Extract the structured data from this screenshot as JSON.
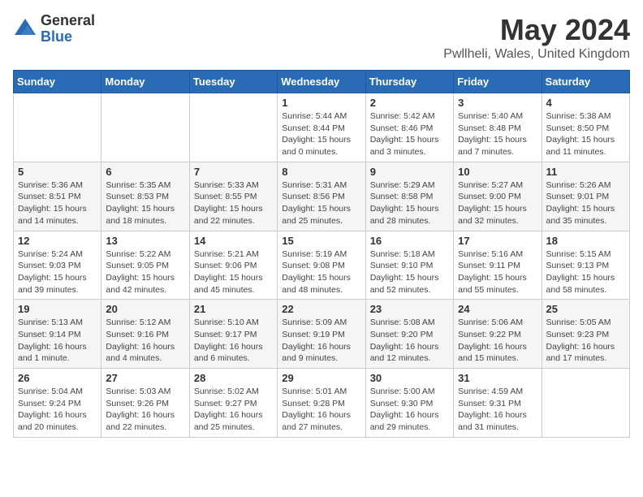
{
  "logo": {
    "general": "General",
    "blue": "Blue"
  },
  "header": {
    "title": "May 2024",
    "subtitle": "Pwllheli, Wales, United Kingdom"
  },
  "weekdays": [
    "Sunday",
    "Monday",
    "Tuesday",
    "Wednesday",
    "Thursday",
    "Friday",
    "Saturday"
  ],
  "weeks": [
    [
      {
        "day": "",
        "info": ""
      },
      {
        "day": "",
        "info": ""
      },
      {
        "day": "",
        "info": ""
      },
      {
        "day": "1",
        "info": "Sunrise: 5:44 AM\nSunset: 8:44 PM\nDaylight: 15 hours\nand 0 minutes."
      },
      {
        "day": "2",
        "info": "Sunrise: 5:42 AM\nSunset: 8:46 PM\nDaylight: 15 hours\nand 3 minutes."
      },
      {
        "day": "3",
        "info": "Sunrise: 5:40 AM\nSunset: 8:48 PM\nDaylight: 15 hours\nand 7 minutes."
      },
      {
        "day": "4",
        "info": "Sunrise: 5:38 AM\nSunset: 8:50 PM\nDaylight: 15 hours\nand 11 minutes."
      }
    ],
    [
      {
        "day": "5",
        "info": "Sunrise: 5:36 AM\nSunset: 8:51 PM\nDaylight: 15 hours\nand 14 minutes."
      },
      {
        "day": "6",
        "info": "Sunrise: 5:35 AM\nSunset: 8:53 PM\nDaylight: 15 hours\nand 18 minutes."
      },
      {
        "day": "7",
        "info": "Sunrise: 5:33 AM\nSunset: 8:55 PM\nDaylight: 15 hours\nand 22 minutes."
      },
      {
        "day": "8",
        "info": "Sunrise: 5:31 AM\nSunset: 8:56 PM\nDaylight: 15 hours\nand 25 minutes."
      },
      {
        "day": "9",
        "info": "Sunrise: 5:29 AM\nSunset: 8:58 PM\nDaylight: 15 hours\nand 28 minutes."
      },
      {
        "day": "10",
        "info": "Sunrise: 5:27 AM\nSunset: 9:00 PM\nDaylight: 15 hours\nand 32 minutes."
      },
      {
        "day": "11",
        "info": "Sunrise: 5:26 AM\nSunset: 9:01 PM\nDaylight: 15 hours\nand 35 minutes."
      }
    ],
    [
      {
        "day": "12",
        "info": "Sunrise: 5:24 AM\nSunset: 9:03 PM\nDaylight: 15 hours\nand 39 minutes."
      },
      {
        "day": "13",
        "info": "Sunrise: 5:22 AM\nSunset: 9:05 PM\nDaylight: 15 hours\nand 42 minutes."
      },
      {
        "day": "14",
        "info": "Sunrise: 5:21 AM\nSunset: 9:06 PM\nDaylight: 15 hours\nand 45 minutes."
      },
      {
        "day": "15",
        "info": "Sunrise: 5:19 AM\nSunset: 9:08 PM\nDaylight: 15 hours\nand 48 minutes."
      },
      {
        "day": "16",
        "info": "Sunrise: 5:18 AM\nSunset: 9:10 PM\nDaylight: 15 hours\nand 52 minutes."
      },
      {
        "day": "17",
        "info": "Sunrise: 5:16 AM\nSunset: 9:11 PM\nDaylight: 15 hours\nand 55 minutes."
      },
      {
        "day": "18",
        "info": "Sunrise: 5:15 AM\nSunset: 9:13 PM\nDaylight: 15 hours\nand 58 minutes."
      }
    ],
    [
      {
        "day": "19",
        "info": "Sunrise: 5:13 AM\nSunset: 9:14 PM\nDaylight: 16 hours\nand 1 minute."
      },
      {
        "day": "20",
        "info": "Sunrise: 5:12 AM\nSunset: 9:16 PM\nDaylight: 16 hours\nand 4 minutes."
      },
      {
        "day": "21",
        "info": "Sunrise: 5:10 AM\nSunset: 9:17 PM\nDaylight: 16 hours\nand 6 minutes."
      },
      {
        "day": "22",
        "info": "Sunrise: 5:09 AM\nSunset: 9:19 PM\nDaylight: 16 hours\nand 9 minutes."
      },
      {
        "day": "23",
        "info": "Sunrise: 5:08 AM\nSunset: 9:20 PM\nDaylight: 16 hours\nand 12 minutes."
      },
      {
        "day": "24",
        "info": "Sunrise: 5:06 AM\nSunset: 9:22 PM\nDaylight: 16 hours\nand 15 minutes."
      },
      {
        "day": "25",
        "info": "Sunrise: 5:05 AM\nSunset: 9:23 PM\nDaylight: 16 hours\nand 17 minutes."
      }
    ],
    [
      {
        "day": "26",
        "info": "Sunrise: 5:04 AM\nSunset: 9:24 PM\nDaylight: 16 hours\nand 20 minutes."
      },
      {
        "day": "27",
        "info": "Sunrise: 5:03 AM\nSunset: 9:26 PM\nDaylight: 16 hours\nand 22 minutes."
      },
      {
        "day": "28",
        "info": "Sunrise: 5:02 AM\nSunset: 9:27 PM\nDaylight: 16 hours\nand 25 minutes."
      },
      {
        "day": "29",
        "info": "Sunrise: 5:01 AM\nSunset: 9:28 PM\nDaylight: 16 hours\nand 27 minutes."
      },
      {
        "day": "30",
        "info": "Sunrise: 5:00 AM\nSunset: 9:30 PM\nDaylight: 16 hours\nand 29 minutes."
      },
      {
        "day": "31",
        "info": "Sunrise: 4:59 AM\nSunset: 9:31 PM\nDaylight: 16 hours\nand 31 minutes."
      },
      {
        "day": "",
        "info": ""
      }
    ]
  ]
}
